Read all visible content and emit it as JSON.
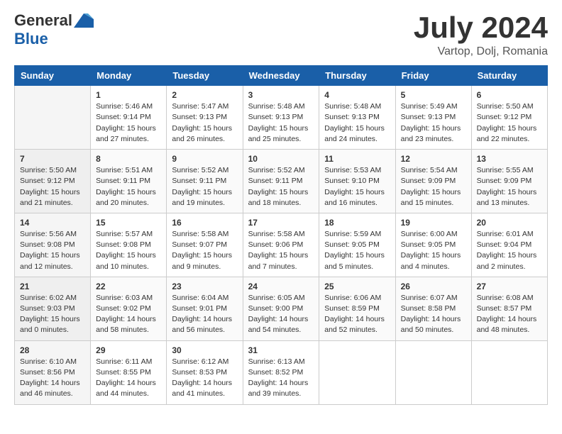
{
  "header": {
    "logo_general": "General",
    "logo_blue": "Blue",
    "month": "July 2024",
    "location": "Vartop, Dolj, Romania"
  },
  "days_of_week": [
    "Sunday",
    "Monday",
    "Tuesday",
    "Wednesday",
    "Thursday",
    "Friday",
    "Saturday"
  ],
  "weeks": [
    [
      {
        "day": "",
        "info": ""
      },
      {
        "day": "1",
        "info": "Sunrise: 5:46 AM\nSunset: 9:14 PM\nDaylight: 15 hours\nand 27 minutes."
      },
      {
        "day": "2",
        "info": "Sunrise: 5:47 AM\nSunset: 9:13 PM\nDaylight: 15 hours\nand 26 minutes."
      },
      {
        "day": "3",
        "info": "Sunrise: 5:48 AM\nSunset: 9:13 PM\nDaylight: 15 hours\nand 25 minutes."
      },
      {
        "day": "4",
        "info": "Sunrise: 5:48 AM\nSunset: 9:13 PM\nDaylight: 15 hours\nand 24 minutes."
      },
      {
        "day": "5",
        "info": "Sunrise: 5:49 AM\nSunset: 9:13 PM\nDaylight: 15 hours\nand 23 minutes."
      },
      {
        "day": "6",
        "info": "Sunrise: 5:50 AM\nSunset: 9:12 PM\nDaylight: 15 hours\nand 22 minutes."
      }
    ],
    [
      {
        "day": "7",
        "info": "Sunrise: 5:50 AM\nSunset: 9:12 PM\nDaylight: 15 hours\nand 21 minutes."
      },
      {
        "day": "8",
        "info": "Sunrise: 5:51 AM\nSunset: 9:11 PM\nDaylight: 15 hours\nand 20 minutes."
      },
      {
        "day": "9",
        "info": "Sunrise: 5:52 AM\nSunset: 9:11 PM\nDaylight: 15 hours\nand 19 minutes."
      },
      {
        "day": "10",
        "info": "Sunrise: 5:52 AM\nSunset: 9:11 PM\nDaylight: 15 hours\nand 18 minutes."
      },
      {
        "day": "11",
        "info": "Sunrise: 5:53 AM\nSunset: 9:10 PM\nDaylight: 15 hours\nand 16 minutes."
      },
      {
        "day": "12",
        "info": "Sunrise: 5:54 AM\nSunset: 9:09 PM\nDaylight: 15 hours\nand 15 minutes."
      },
      {
        "day": "13",
        "info": "Sunrise: 5:55 AM\nSunset: 9:09 PM\nDaylight: 15 hours\nand 13 minutes."
      }
    ],
    [
      {
        "day": "14",
        "info": "Sunrise: 5:56 AM\nSunset: 9:08 PM\nDaylight: 15 hours\nand 12 minutes."
      },
      {
        "day": "15",
        "info": "Sunrise: 5:57 AM\nSunset: 9:08 PM\nDaylight: 15 hours\nand 10 minutes."
      },
      {
        "day": "16",
        "info": "Sunrise: 5:58 AM\nSunset: 9:07 PM\nDaylight: 15 hours\nand 9 minutes."
      },
      {
        "day": "17",
        "info": "Sunrise: 5:58 AM\nSunset: 9:06 PM\nDaylight: 15 hours\nand 7 minutes."
      },
      {
        "day": "18",
        "info": "Sunrise: 5:59 AM\nSunset: 9:05 PM\nDaylight: 15 hours\nand 5 minutes."
      },
      {
        "day": "19",
        "info": "Sunrise: 6:00 AM\nSunset: 9:05 PM\nDaylight: 15 hours\nand 4 minutes."
      },
      {
        "day": "20",
        "info": "Sunrise: 6:01 AM\nSunset: 9:04 PM\nDaylight: 15 hours\nand 2 minutes."
      }
    ],
    [
      {
        "day": "21",
        "info": "Sunrise: 6:02 AM\nSunset: 9:03 PM\nDaylight: 15 hours\nand 0 minutes."
      },
      {
        "day": "22",
        "info": "Sunrise: 6:03 AM\nSunset: 9:02 PM\nDaylight: 14 hours\nand 58 minutes."
      },
      {
        "day": "23",
        "info": "Sunrise: 6:04 AM\nSunset: 9:01 PM\nDaylight: 14 hours\nand 56 minutes."
      },
      {
        "day": "24",
        "info": "Sunrise: 6:05 AM\nSunset: 9:00 PM\nDaylight: 14 hours\nand 54 minutes."
      },
      {
        "day": "25",
        "info": "Sunrise: 6:06 AM\nSunset: 8:59 PM\nDaylight: 14 hours\nand 52 minutes."
      },
      {
        "day": "26",
        "info": "Sunrise: 6:07 AM\nSunset: 8:58 PM\nDaylight: 14 hours\nand 50 minutes."
      },
      {
        "day": "27",
        "info": "Sunrise: 6:08 AM\nSunset: 8:57 PM\nDaylight: 14 hours\nand 48 minutes."
      }
    ],
    [
      {
        "day": "28",
        "info": "Sunrise: 6:10 AM\nSunset: 8:56 PM\nDaylight: 14 hours\nand 46 minutes."
      },
      {
        "day": "29",
        "info": "Sunrise: 6:11 AM\nSunset: 8:55 PM\nDaylight: 14 hours\nand 44 minutes."
      },
      {
        "day": "30",
        "info": "Sunrise: 6:12 AM\nSunset: 8:53 PM\nDaylight: 14 hours\nand 41 minutes."
      },
      {
        "day": "31",
        "info": "Sunrise: 6:13 AM\nSunset: 8:52 PM\nDaylight: 14 hours\nand 39 minutes."
      },
      {
        "day": "",
        "info": ""
      },
      {
        "day": "",
        "info": ""
      },
      {
        "day": "",
        "info": ""
      }
    ]
  ]
}
